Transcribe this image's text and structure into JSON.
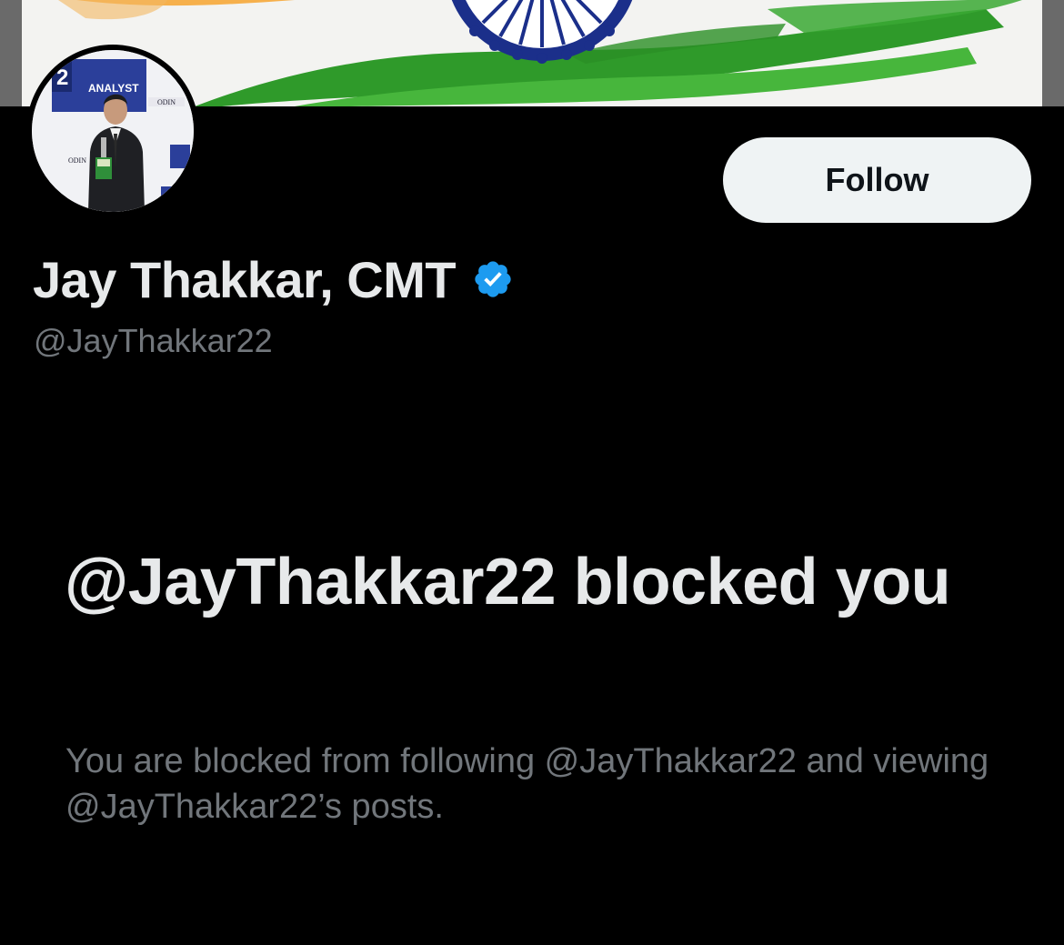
{
  "profile": {
    "display_name": "Jay Thakkar, CMT",
    "handle": "@JayThakkar22",
    "verified_icon": "verified-badge-icon",
    "follow_label": "Follow",
    "avatar_award_text": "ANALYST",
    "avatar_brand": "ODIN"
  },
  "blocked": {
    "title": "@JayThakkar22 blocked you",
    "description": "You are blocked from following @JayThakkar22 and viewing @JayThakkar22’s posts."
  },
  "colors": {
    "background": "#000000",
    "primary_text": "#e7e9ea",
    "secondary_text": "#71767b",
    "follow_button_bg": "#eff3f4",
    "verified_blue": "#1d9bf0",
    "flag_saffron": "#ff9933",
    "flag_green": "#138808",
    "chakra_blue": "#000080"
  }
}
